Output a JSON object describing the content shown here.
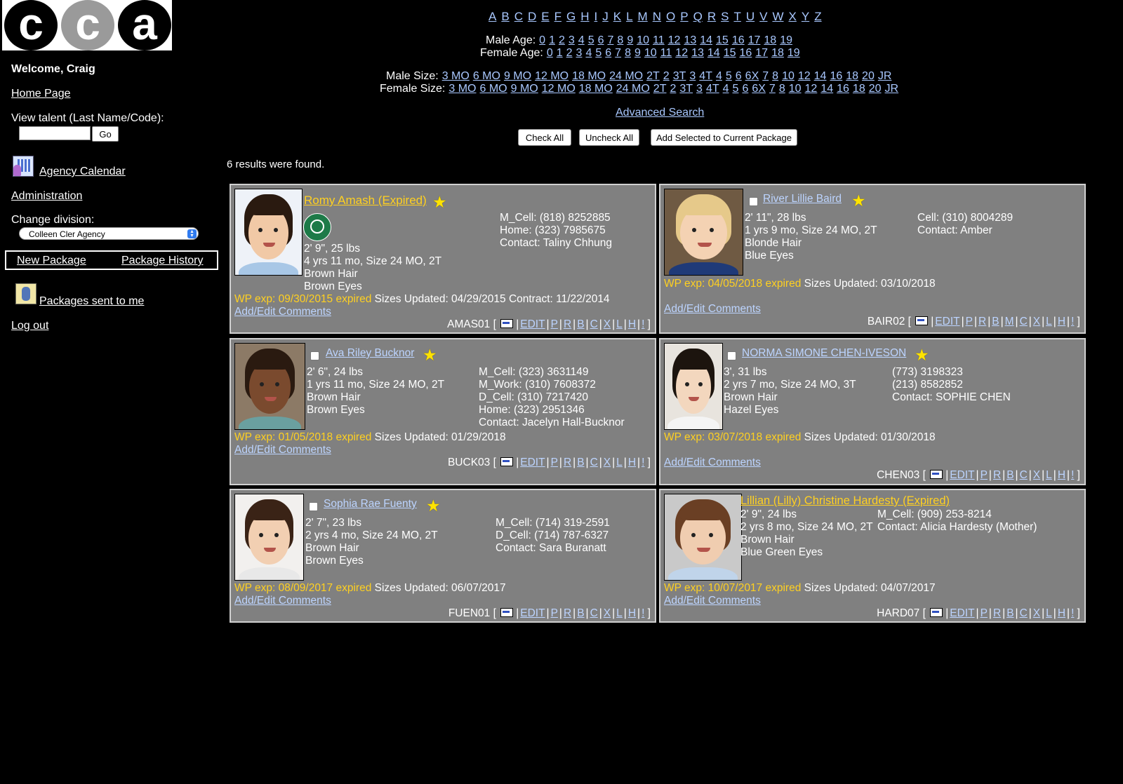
{
  "sidebar": {
    "logo_letters": [
      "c",
      "c",
      "a"
    ],
    "welcome": "Welcome, Craig",
    "home": "Home Page",
    "view_talent_label": "View talent (Last Name/Code):",
    "view_talent_value": "",
    "go": "Go",
    "agency_calendar": "Agency Calendar",
    "administration": "Administration",
    "change_division_label": "Change division:",
    "division_selected": "Colleen Cler Agency",
    "new_package": "New Package",
    "package_history": "Package History",
    "packages_sent": "Packages sent to me",
    "logout": "Log out"
  },
  "nav": {
    "alphabet": [
      "A",
      "B",
      "C",
      "D",
      "E",
      "F",
      "G",
      "H",
      "I",
      "J",
      "K",
      "L",
      "M",
      "N",
      "O",
      "P",
      "Q",
      "R",
      "S",
      "T",
      "U",
      "V",
      "W",
      "X",
      "Y",
      "Z"
    ],
    "male_age_label": "Male Age:",
    "female_age_label": "Female Age:",
    "ages": [
      "0",
      "1",
      "2",
      "3",
      "4",
      "5",
      "6",
      "7",
      "8",
      "9",
      "10",
      "11",
      "12",
      "13",
      "14",
      "15",
      "16",
      "17",
      "18",
      "19"
    ],
    "male_size_label": "Male Size:",
    "female_size_label": "Female Size:",
    "sizes": [
      "3 MO",
      "6 MO",
      "9 MO",
      "12 MO",
      "18 MO",
      "24 MO",
      "2T",
      "2",
      "3T",
      "3",
      "4T",
      "4",
      "5",
      "6",
      "6X",
      "7",
      "8",
      "10",
      "12",
      "14",
      "16",
      "18",
      "20",
      "JR"
    ],
    "advanced_search": "Advanced Search",
    "check_all": "Check All",
    "uncheck_all": "Uncheck All",
    "add_selected": "Add Selected to Current Package"
  },
  "results_text": "6 results were found.",
  "footer_links": [
    "EDIT",
    "P",
    "R",
    "B",
    "C",
    "X",
    "L",
    "H",
    "!"
  ],
  "footer_links_bair": [
    "EDIT",
    "P",
    "R",
    "B",
    "M",
    "C",
    "X",
    "L",
    "H",
    "!"
  ],
  "talent": [
    {
      "name": "Romy Amash (Expired)",
      "expired": true,
      "checkbox": false,
      "info": "2' 9\", 25 lbs\n4 yrs 11 mo, Size 24 MO, 2T\nBrown Hair\nBrown Eyes",
      "contact": "M_Cell: (818) 8252885\nHome: (323) 7985675\nContact: Taliny Chhung",
      "wp": "WP exp: 09/30/2015 expired",
      "rest": " Sizes Updated: 04/29/2015 Contract: 11/22/2014",
      "comments": "Add/Edit Comments",
      "code": "AMAS01",
      "star": "★"
    },
    {
      "name": "River Lillie Baird",
      "expired": false,
      "checkbox": true,
      "info": "2' 11\", 28 lbs\n1 yrs 9 mo, Size 24 MO, 2T\nBlonde Hair\nBlue Eyes",
      "contact": "Cell: (310) 8004289\nContact: Amber",
      "wp": "WP exp: 04/05/2018 expired",
      "rest": " Sizes Updated: 03/10/2018",
      "comments": "Add/Edit Comments",
      "code": "BAIR02",
      "star": "★"
    },
    {
      "name": "Ava Riley Bucknor",
      "expired": false,
      "checkbox": true,
      "info": "2' 6\", 24 lbs\n1 yrs 11 mo, Size 24 MO, 2T\nBrown Hair\nBrown Eyes",
      "contact": "M_Cell: (323) 3631149\nM_Work: (310) 7608372\nD_Cell: (310) 7217420\nHome: (323) 2951346\nContact: Jacelyn Hall-Bucknor",
      "wp": "WP exp: 01/05/2018 expired",
      "rest": " Sizes Updated: 01/29/2018",
      "comments": "Add/Edit Comments",
      "code": "BUCK03",
      "star": "★"
    },
    {
      "name": "NORMA SIMONE CHEN-IVESON",
      "expired": false,
      "checkbox": true,
      "info": "3', 31 lbs\n2 yrs 7 mo, Size 24 MO, 3T\nBrown Hair\nHazel Eyes",
      "contact": "(773) 3198323\n(213) 8582852\nContact: SOPHIE CHEN",
      "wp": "WP exp: 03/07/2018 expired",
      "rest": " Sizes Updated: 01/30/2018",
      "comments": "Add/Edit Comments",
      "code": "CHEN03",
      "star": "★"
    },
    {
      "name": "Sophia Rae Fuenty",
      "expired": false,
      "checkbox": true,
      "info": "2' 7\", 23 lbs\n2 yrs 4 mo, Size 24 MO, 2T\nBrown Hair\nBrown Eyes",
      "contact": "M_Cell: (714) 319-2591\nD_Cell: (714) 787-6327\nContact: Sara Buranatt",
      "wp": "WP exp: 08/09/2017 expired",
      "rest": " Sizes Updated: 06/07/2017",
      "comments": "Add/Edit Comments",
      "code": "FUEN01",
      "star": "★"
    },
    {
      "name": "Lillian (Lilly) Christine Hardesty (Expired)",
      "expired": true,
      "checkbox": false,
      "info": "2' 9\", 24 lbs\n2 yrs 8 mo, Size 24 MO, 2T\nBrown Hair\nBlue Green Eyes",
      "contact": "M_Cell: (909) 253-8214\nContact: Alicia Hardesty (Mother)",
      "wp": "WP exp: 10/07/2017 expired",
      "rest": " Sizes Updated: 04/07/2017",
      "comments": "Add/Edit Comments",
      "code": "HARD07",
      "star": "★"
    }
  ],
  "colors": {
    "link": "#a9c8ff",
    "expired": "#ffd020",
    "card_bg": "#808080",
    "star": "#ffe300"
  }
}
